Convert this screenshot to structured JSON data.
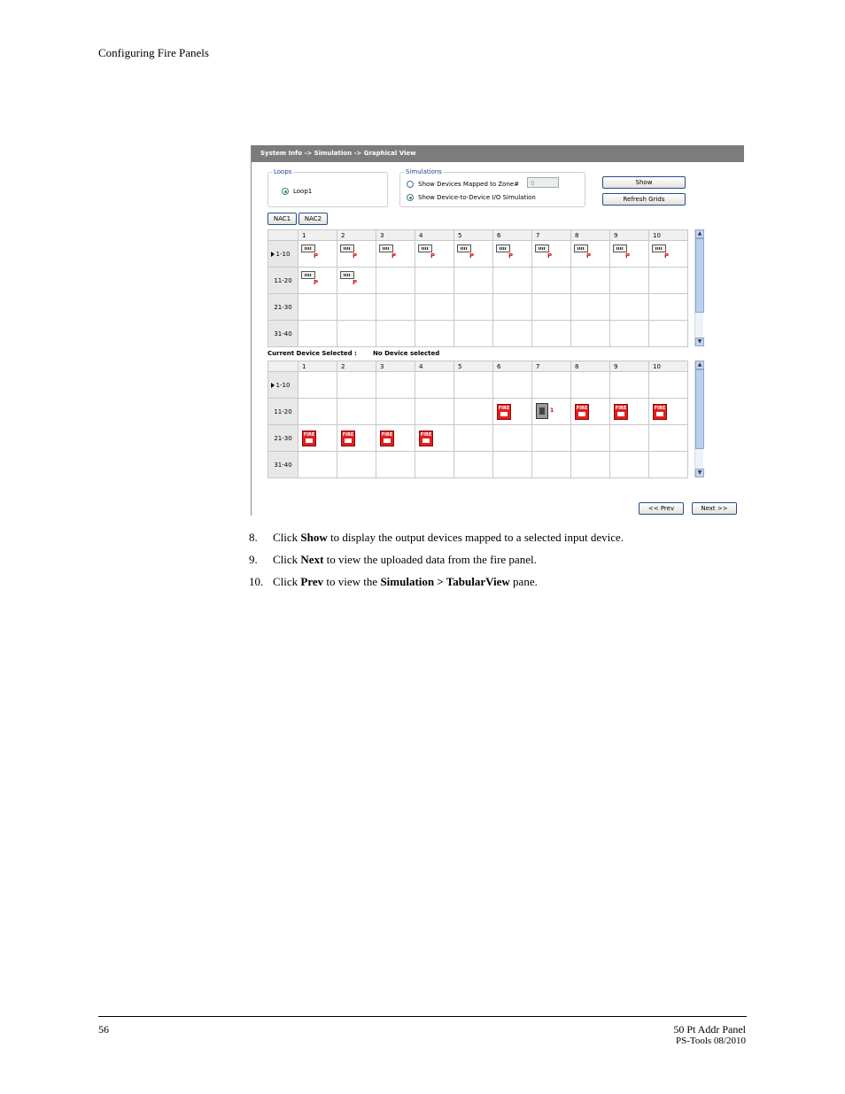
{
  "header": {
    "section_title": "Configuring Fire Panels"
  },
  "screenshot": {
    "breadcrumb": "System Info -> Simulation -> Graphical View",
    "loops": {
      "legend": "Loops",
      "options": [
        "Loop1"
      ]
    },
    "simulations": {
      "legend": "Simulations",
      "option_zone": "Show Devices Mapped to Zone#",
      "zone_value": "0",
      "option_io": "Show Device-to-Device I/O Simulation"
    },
    "buttons": {
      "show": "Show",
      "refresh": "Refresh Grids",
      "nac1": "NAC1",
      "nac2": "NAC2",
      "prev": "<< Prev",
      "next": "Next >>"
    },
    "columns": [
      "1",
      "2",
      "3",
      "4",
      "5",
      "6",
      "7",
      "8",
      "9",
      "10"
    ],
    "rows": [
      "1-10",
      "11-20",
      "21-30",
      "31-40"
    ],
    "top_grid": {
      "cells": [
        [
          "detector",
          "detector",
          "detector",
          "detector",
          "detector",
          "detector",
          "detector",
          "detector",
          "detector",
          "detector"
        ],
        [
          "detector",
          "detector",
          "",
          "",
          "",
          "",
          "",
          "",
          "",
          ""
        ],
        [
          "",
          "",
          "",
          "",
          "",
          "",
          "",
          "",
          "",
          ""
        ],
        [
          "",
          "",
          "",
          "",
          "",
          "",
          "",
          "",
          "",
          ""
        ]
      ],
      "marker": "P"
    },
    "current_device_label": "Current Device Selected :",
    "current_device_value": "No Device selected",
    "bottom_grid": {
      "cells": [
        [
          "",
          "",
          "",
          "",
          "",
          "",
          "",
          "",
          "",
          ""
        ],
        [
          "",
          "",
          "",
          "",
          "",
          "pull-station",
          "module",
          "pull-station",
          "pull-station",
          "pull-station"
        ],
        [
          "pull-station",
          "pull-station",
          "pull-station",
          "pull-station",
          "",
          "",
          "",
          "",
          "",
          ""
        ],
        [
          "",
          "",
          "",
          "",
          "",
          "",
          "",
          "",
          "",
          ""
        ]
      ],
      "pull_station_text": "FIRE",
      "module_marker": "1"
    }
  },
  "steps": [
    {
      "num": "8.",
      "parts": [
        "Click ",
        "Show",
        " to display the output devices mapped to a selected input device."
      ]
    },
    {
      "num": "9.",
      "parts": [
        "Click ",
        "Next",
        " to view the uploaded data from the fire panel."
      ]
    },
    {
      "num": "10.",
      "parts": [
        "Click ",
        "Prev",
        " to view the ",
        "Simulation > TabularView",
        " pane."
      ]
    }
  ],
  "footer": {
    "page_number": "56",
    "product": "50 Pt Addr Panel",
    "doc_id": "PS-Tools 08/2010"
  }
}
